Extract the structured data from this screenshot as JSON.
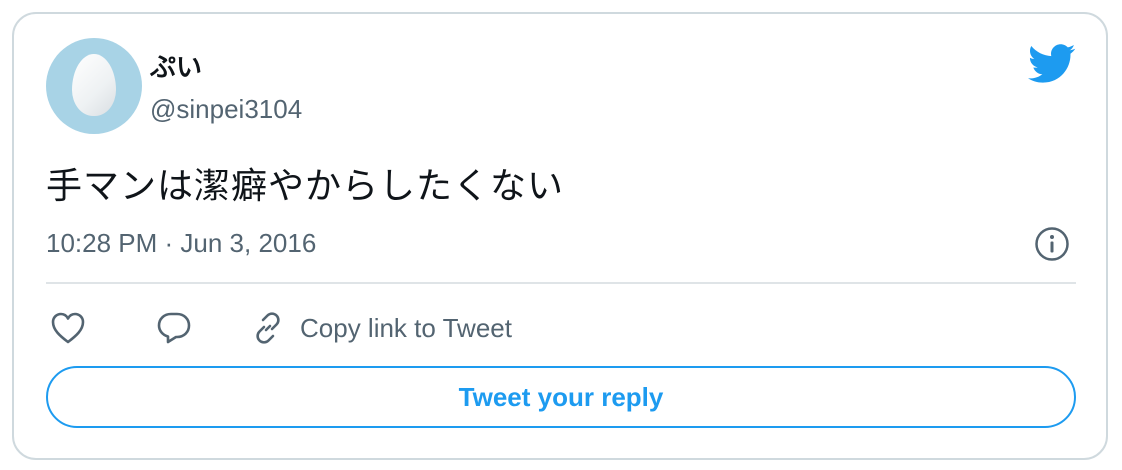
{
  "tweet": {
    "display_name": "ぷい",
    "handle": "@sinpei3104",
    "text": "手マンは潔癖やからしたくない",
    "timestamp": "10:28 PM · Jun 3, 2016"
  },
  "actions": {
    "like_icon": "heart-icon",
    "reply_icon": "speech-bubble-icon",
    "copy_link_icon": "link-icon",
    "copy_link_label": "Copy link to Tweet"
  },
  "reply_button": {
    "label": "Tweet your reply"
  },
  "icons": {
    "brand": "twitter-bird-icon",
    "info": "info-icon"
  },
  "colors": {
    "accent": "#1d9bf0",
    "text_primary": "#0f1419",
    "text_secondary": "#536471",
    "border": "#cfd9de",
    "avatar_bg": "#a8d3e6"
  }
}
